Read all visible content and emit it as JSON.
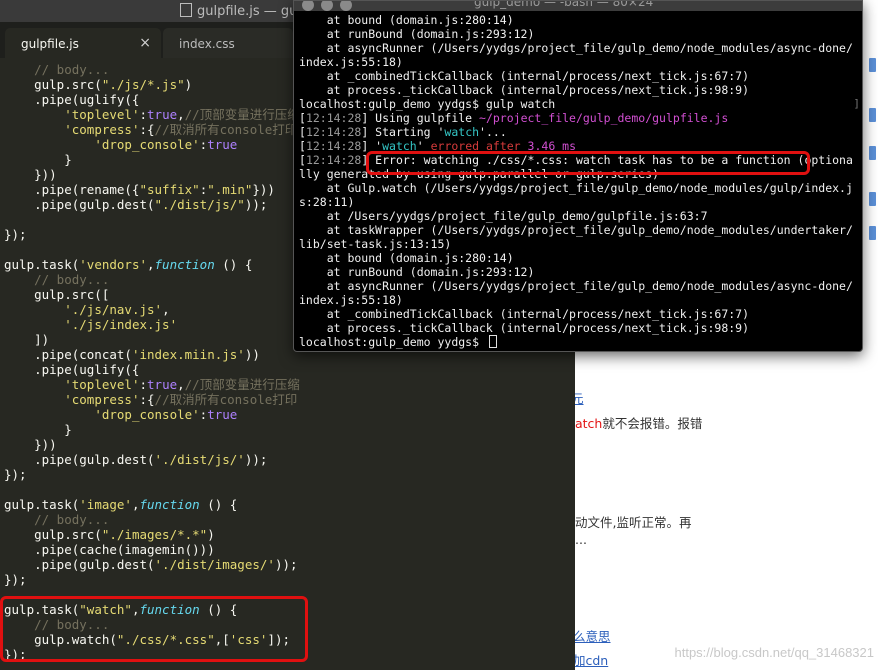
{
  "editor": {
    "window_title": "gulpfile.js — gul",
    "tabs": [
      {
        "label": "gulpfile.js",
        "close": "×",
        "active": true
      },
      {
        "label": "index.css",
        "active": false
      }
    ],
    "code_lines": [
      [
        {
          "t": "    // body...",
          "c": "c"
        }
      ],
      [
        {
          "t": "    gulp.src("
        },
        {
          "t": "\"./js/*.js\"",
          "c": "s"
        },
        {
          "t": ")"
        }
      ],
      [
        {
          "t": "    .pipe(uglify({"
        }
      ],
      [
        {
          "t": "        "
        },
        {
          "t": "'toplevel'",
          "c": "s"
        },
        {
          "t": ":"
        },
        {
          "t": "true",
          "c": "b"
        },
        {
          "t": ","
        },
        {
          "t": "//顶部变量进行压缩",
          "c": "c"
        }
      ],
      [
        {
          "t": "        "
        },
        {
          "t": "'compress'",
          "c": "s"
        },
        {
          "t": ":{"
        },
        {
          "t": "//取消所有console打印",
          "c": "c"
        }
      ],
      [
        {
          "t": "            "
        },
        {
          "t": "'drop_console'",
          "c": "s"
        },
        {
          "t": ":"
        },
        {
          "t": "true",
          "c": "b"
        }
      ],
      [
        {
          "t": "        }"
        }
      ],
      [
        {
          "t": "    }))"
        }
      ],
      [
        {
          "t": "    .pipe(rename({"
        },
        {
          "t": "\"suffix\"",
          "c": "s"
        },
        {
          "t": ":"
        },
        {
          "t": "\".min\"",
          "c": "s"
        },
        {
          "t": "}))"
        }
      ],
      [
        {
          "t": "    .pipe(gulp.dest("
        },
        {
          "t": "\"./dist/js/\"",
          "c": "s"
        },
        {
          "t": "));"
        }
      ],
      [
        {
          "t": ""
        }
      ],
      [
        {
          "t": "});"
        }
      ],
      [
        {
          "t": ""
        }
      ],
      [
        {
          "t": "gulp.task("
        },
        {
          "t": "'vendors'",
          "c": "s"
        },
        {
          "t": ","
        },
        {
          "t": "function",
          "c": "k"
        },
        {
          "t": " () {"
        }
      ],
      [
        {
          "t": "    // body...",
          "c": "c"
        }
      ],
      [
        {
          "t": "    gulp.src(["
        }
      ],
      [
        {
          "t": "        "
        },
        {
          "t": "'./js/nav.js'",
          "c": "s"
        },
        {
          "t": ","
        }
      ],
      [
        {
          "t": "        "
        },
        {
          "t": "'./js/index.js'",
          "c": "s"
        }
      ],
      [
        {
          "t": "    ])"
        }
      ],
      [
        {
          "t": "    .pipe(concat("
        },
        {
          "t": "'index.miin.js'",
          "c": "s"
        },
        {
          "t": "))"
        }
      ],
      [
        {
          "t": "    .pipe(uglify({"
        }
      ],
      [
        {
          "t": "        "
        },
        {
          "t": "'toplevel'",
          "c": "s"
        },
        {
          "t": ":"
        },
        {
          "t": "true",
          "c": "b"
        },
        {
          "t": ","
        },
        {
          "t": "//顶部变量进行压缩",
          "c": "c"
        }
      ],
      [
        {
          "t": "        "
        },
        {
          "t": "'compress'",
          "c": "s"
        },
        {
          "t": ":{"
        },
        {
          "t": "//取消所有console打印",
          "c": "c"
        }
      ],
      [
        {
          "t": "            "
        },
        {
          "t": "'drop_console'",
          "c": "s"
        },
        {
          "t": ":"
        },
        {
          "t": "true",
          "c": "b"
        }
      ],
      [
        {
          "t": "        }"
        }
      ],
      [
        {
          "t": "    }))"
        }
      ],
      [
        {
          "t": "    .pipe(gulp.dest("
        },
        {
          "t": "'./dist/js/'",
          "c": "s"
        },
        {
          "t": "));"
        }
      ],
      [
        {
          "t": "});"
        }
      ],
      [
        {
          "t": ""
        }
      ],
      [
        {
          "t": "gulp.task("
        },
        {
          "t": "'image'",
          "c": "s"
        },
        {
          "t": ","
        },
        {
          "t": "function",
          "c": "k"
        },
        {
          "t": " () {"
        }
      ],
      [
        {
          "t": "    // body...",
          "c": "c"
        }
      ],
      [
        {
          "t": "    gulp.src("
        },
        {
          "t": "\"./images/*.*\"",
          "c": "s"
        },
        {
          "t": ")"
        }
      ],
      [
        {
          "t": "    .pipe(cache(imagemin()))"
        }
      ],
      [
        {
          "t": "    .pipe(gulp.dest("
        },
        {
          "t": "'./dist/images/'",
          "c": "s"
        },
        {
          "t": "));"
        }
      ],
      [
        {
          "t": "});"
        }
      ],
      [
        {
          "t": ""
        }
      ],
      [
        {
          "t": "gulp.task("
        },
        {
          "t": "\"watch\"",
          "c": "s"
        },
        {
          "t": ","
        },
        {
          "t": "function",
          "c": "k"
        },
        {
          "t": " () {"
        }
      ],
      [
        {
          "t": "    // body...",
          "c": "c"
        }
      ],
      [
        {
          "t": "    gulp.watch("
        },
        {
          "t": "\"./css/*.css\"",
          "c": "s"
        },
        {
          "t": ",["
        },
        {
          "t": "'css'",
          "c": "s"
        },
        {
          "t": "]);"
        }
      ],
      [
        {
          "t": "});"
        }
      ]
    ]
  },
  "terminal": {
    "title": "gulp_demo — -bash — 80×24",
    "ruler": "]",
    "lines": [
      [
        {
          "t": "    at bound (domain.js:280:14)"
        }
      ],
      [
        {
          "t": "    at runBound (domain.js:293:12)"
        }
      ],
      [
        {
          "t": "    at asyncRunner (/Users/yydgs/project_file/gulp_demo/node_modules/async-done/"
        }
      ],
      [
        {
          "t": "index.js:55:18)"
        }
      ],
      [
        {
          "t": "    at _combinedTickCallback (internal/process/next_tick.js:67:7)"
        }
      ],
      [
        {
          "t": "    at process._tickCallback (internal/process/next_tick.js:98:9)"
        }
      ],
      [
        {
          "t": "localhost:gulp_demo yydgs$ gulp watch"
        }
      ],
      [
        {
          "t": "["
        },
        {
          "t": "12:14:28",
          "c": "time"
        },
        {
          "t": "] Using gulpfile "
        },
        {
          "t": "~/project_file/gulp_demo/gulpfile.js",
          "c": "mag"
        }
      ],
      [
        {
          "t": "["
        },
        {
          "t": "12:14:28",
          "c": "time"
        },
        {
          "t": "] Starting '"
        },
        {
          "t": "watch",
          "c": "cyan"
        },
        {
          "t": "'..."
        }
      ],
      [
        {
          "t": "["
        },
        {
          "t": "12:14:28",
          "c": "time"
        },
        {
          "t": "] '"
        },
        {
          "t": "watch",
          "c": "cyan"
        },
        {
          "t": "' "
        },
        {
          "t": "errored after",
          "c": "red"
        },
        {
          "t": " "
        },
        {
          "t": "3.46 ms",
          "c": "mag"
        }
      ],
      [
        {
          "t": "["
        },
        {
          "t": "12:14:28",
          "c": "time"
        },
        {
          "t": "] Error: watching ./css/*.css: watch task has to be a function (optiona"
        }
      ],
      [
        {
          "t": "lly generated by using gulp.parallel or gulp.series)"
        }
      ],
      [
        {
          "t": "    at Gulp.watch (/Users/yydgs/project_file/gulp_demo/node_modules/gulp/index.j"
        }
      ],
      [
        {
          "t": "s:28:11)"
        }
      ],
      [
        {
          "t": "    at /Users/yydgs/project_file/gulp_demo/gulpfile.js:63:7"
        }
      ],
      [
        {
          "t": "    at taskWrapper (/Users/yydgs/project_file/gulp_demo/node_modules/undertaker/"
        }
      ],
      [
        {
          "t": "lib/set-task.js:13:15)"
        }
      ],
      [
        {
          "t": "    at bound (domain.js:280:14)"
        }
      ],
      [
        {
          "t": "    at runBound (domain.js:293:12)"
        }
      ],
      [
        {
          "t": "    at asyncRunner (/Users/yydgs/project_file/gulp_demo/node_modules/async-done/"
        }
      ],
      [
        {
          "t": "index.js:55:18)"
        }
      ],
      [
        {
          "t": "    at _combinedTickCallback (internal/process/next_tick.js:67:7)"
        }
      ],
      [
        {
          "t": "    at process._tickCallback (internal/process/next_tick.js:98:9)"
        }
      ],
      [
        {
          "t": "localhost:gulp_demo yydgs$ "
        },
        {
          "t": "",
          "c": "cursor"
        }
      ]
    ]
  },
  "browser": {
    "frag_link_top": "元",
    "frag_line2_red": "atch",
    "frag_line2_rest": "就不会报错。报错",
    "frag_line3": "动文件,监听正常。再",
    "frag_line4": "...",
    "frag_link_1": "么意思",
    "frag_link_2": "加cdn",
    "watermark": "https://blog.csdn.net/qq_31468321"
  }
}
